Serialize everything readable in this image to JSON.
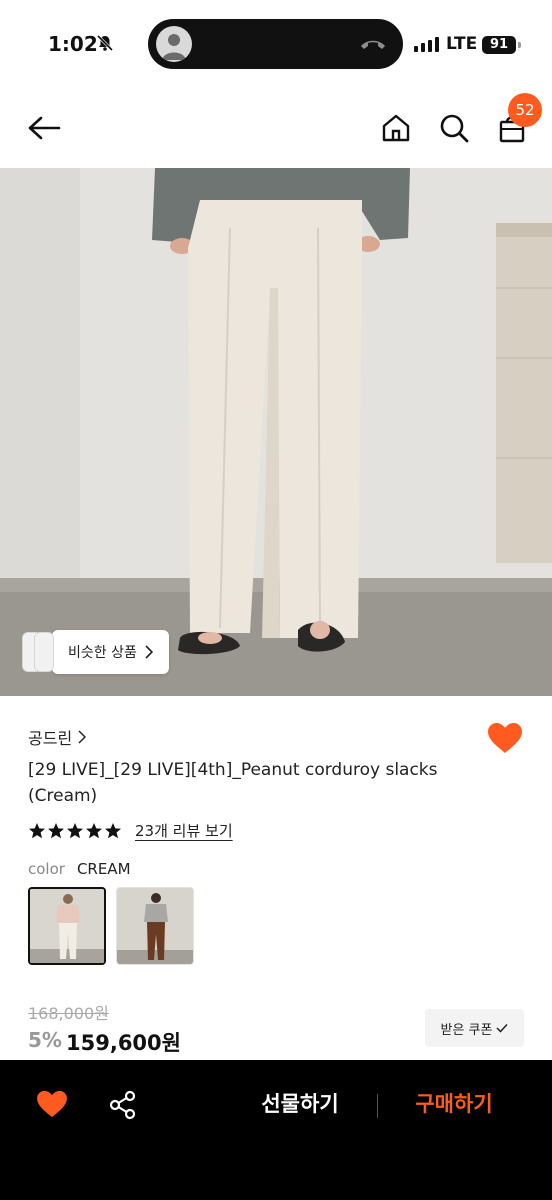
{
  "status_bar": {
    "time": "1:02",
    "network": "LTE",
    "battery": "91"
  },
  "header": {
    "cart_count": "52"
  },
  "hero": {
    "similar_button_label": "비슷한 상품"
  },
  "product": {
    "brand": "공드린",
    "name": "[29 LIVE]_[29 LIVE][4th]_Peanut corduroy slacks (Cream)",
    "rating_stars": 5,
    "review_link": "23개 리뷰 보기",
    "color_label": "color",
    "color_value": "CREAM",
    "original_price": "168,000원",
    "discount": "5%",
    "price": "159,600원",
    "coupon_button": "받은 쿠폰"
  },
  "bottom_bar": {
    "gift_button": "선물하기",
    "buy_button": "구매하기"
  },
  "colors": {
    "accent": "#ff5b1e",
    "heart": "#ff5a1f"
  }
}
